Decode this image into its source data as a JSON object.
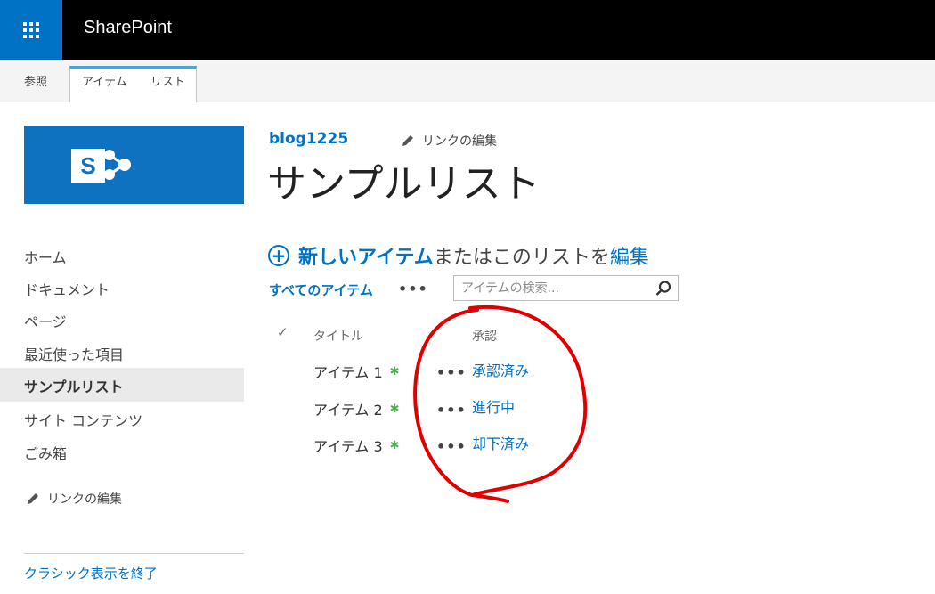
{
  "suite_bar": {
    "app_name": "SharePoint",
    "waffle_icon": "app-launcher-icon",
    "background": "#000000",
    "waffle_color": "#0072c6"
  },
  "ribbon": {
    "tabs": [
      "参照",
      "アイテム",
      "リスト"
    ],
    "active_accent": "#4aa5d6"
  },
  "site": {
    "name": "blog1225",
    "edit_links_label": "リンクの編集"
  },
  "page": {
    "title": "サンプルリスト"
  },
  "new_item": {
    "new_label": "新しいアイテム",
    "middle_text": "またはこのリストを",
    "edit_label": "編集"
  },
  "view": {
    "label": "すべてのアイテム",
    "more": "•••"
  },
  "search": {
    "placeholder": "アイテムの検索..."
  },
  "list": {
    "columns": {
      "title": "タイトル",
      "approval": "承認"
    },
    "rows": [
      {
        "title": "アイテム 1",
        "status": "承認済み"
      },
      {
        "title": "アイテム 2",
        "status": "進行中"
      },
      {
        "title": "アイテム 3",
        "status": "却下済み"
      }
    ],
    "row_menu": "•••"
  },
  "nav": {
    "items": [
      {
        "label": "ホーム"
      },
      {
        "label": "ドキュメント"
      },
      {
        "label": "ページ"
      },
      {
        "label": "最近使った項目"
      },
      {
        "label": "サンプルリスト",
        "selected": true
      },
      {
        "label": "サイト コンテンツ"
      },
      {
        "label": "ごみ箱"
      }
    ],
    "edit_links_label": "リンクの編集",
    "exit_classic": "クラシック表示を終了"
  },
  "colors": {
    "accent": "#0072c6",
    "annotation": "#e00000",
    "new_badge": "#4caf50"
  }
}
